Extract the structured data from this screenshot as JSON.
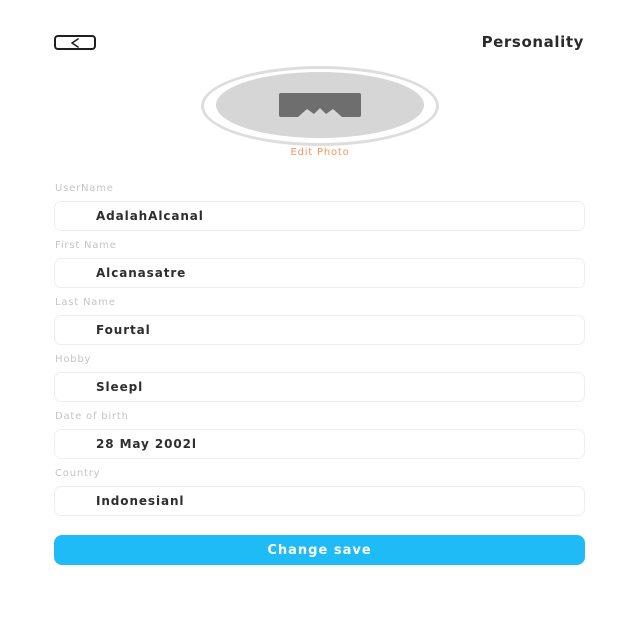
{
  "header": {
    "back_icon": "chevron-left-icon",
    "title": "Personality"
  },
  "profile": {
    "avatar_icon": "image-placeholder-icon",
    "edit_photo_label": "Edit Photo"
  },
  "form": {
    "fields": [
      {
        "label": "UserName",
        "value": "AdalahAlcanal"
      },
      {
        "label": "First Name",
        "value": "Alcanasatre"
      },
      {
        "label": "Last Name",
        "value": "Fourtal"
      },
      {
        "label": "Hobby",
        "value": "Sleepl"
      },
      {
        "label": "Date of birth",
        "value": "28 May 2002l"
      },
      {
        "label": "Country",
        "value": "Indonesianl"
      }
    ]
  },
  "actions": {
    "save_label": "Change save"
  },
  "colors": {
    "accent": "#1fbbf6",
    "edit_photo": "#f2975a",
    "label": "#c4c4c4",
    "avatar_fill": "#d6d6d6"
  }
}
